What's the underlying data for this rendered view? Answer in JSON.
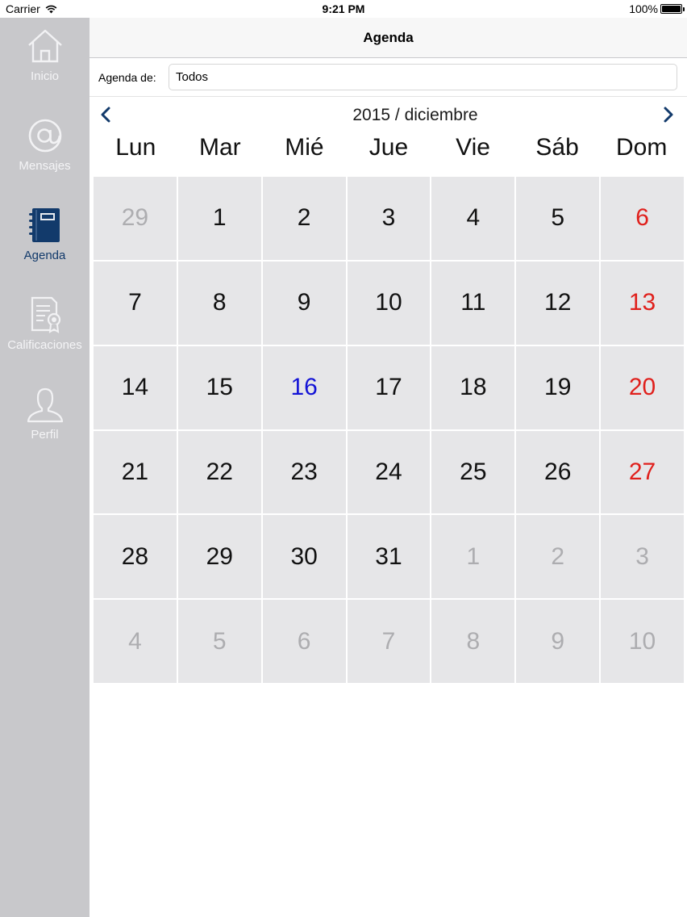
{
  "status_bar": {
    "carrier": "Carrier",
    "time": "9:21 PM",
    "battery": "100%"
  },
  "sidebar": {
    "items": [
      {
        "label": "Inicio",
        "icon": "home-icon",
        "active": false
      },
      {
        "label": "Mensajes",
        "icon": "at-sign-icon",
        "active": false
      },
      {
        "label": "Agenda",
        "icon": "notebook-icon",
        "active": true
      },
      {
        "label": "Calificaciones",
        "icon": "certificate-icon",
        "active": false
      },
      {
        "label": "Perfil",
        "icon": "user-icon",
        "active": false
      }
    ]
  },
  "navbar": {
    "title": "Agenda"
  },
  "filter": {
    "label": "Agenda de:",
    "value": "Todos"
  },
  "calendar": {
    "month_title": "2015 / diciembre",
    "weekdays": [
      "Lun",
      "Mar",
      "Mié",
      "Jue",
      "Vie",
      "Sáb",
      "Dom"
    ],
    "days": [
      {
        "d": "29",
        "type": "other"
      },
      {
        "d": "1",
        "type": "normal"
      },
      {
        "d": "2",
        "type": "normal"
      },
      {
        "d": "3",
        "type": "normal"
      },
      {
        "d": "4",
        "type": "normal"
      },
      {
        "d": "5",
        "type": "normal"
      },
      {
        "d": "6",
        "type": "sun"
      },
      {
        "d": "7",
        "type": "normal"
      },
      {
        "d": "8",
        "type": "normal"
      },
      {
        "d": "9",
        "type": "normal"
      },
      {
        "d": "10",
        "type": "normal"
      },
      {
        "d": "11",
        "type": "normal"
      },
      {
        "d": "12",
        "type": "normal"
      },
      {
        "d": "13",
        "type": "sun"
      },
      {
        "d": "14",
        "type": "normal"
      },
      {
        "d": "15",
        "type": "normal"
      },
      {
        "d": "16",
        "type": "today"
      },
      {
        "d": "17",
        "type": "normal"
      },
      {
        "d": "18",
        "type": "normal"
      },
      {
        "d": "19",
        "type": "normal"
      },
      {
        "d": "20",
        "type": "sun"
      },
      {
        "d": "21",
        "type": "normal"
      },
      {
        "d": "22",
        "type": "normal"
      },
      {
        "d": "23",
        "type": "normal"
      },
      {
        "d": "24",
        "type": "normal"
      },
      {
        "d": "25",
        "type": "normal"
      },
      {
        "d": "26",
        "type": "normal"
      },
      {
        "d": "27",
        "type": "sun"
      },
      {
        "d": "28",
        "type": "normal"
      },
      {
        "d": "29",
        "type": "normal"
      },
      {
        "d": "30",
        "type": "normal"
      },
      {
        "d": "31",
        "type": "normal"
      },
      {
        "d": "1",
        "type": "other"
      },
      {
        "d": "2",
        "type": "other"
      },
      {
        "d": "3",
        "type": "other"
      },
      {
        "d": "4",
        "type": "other"
      },
      {
        "d": "5",
        "type": "other"
      },
      {
        "d": "6",
        "type": "other"
      },
      {
        "d": "7",
        "type": "other"
      },
      {
        "d": "8",
        "type": "other"
      },
      {
        "d": "9",
        "type": "other"
      },
      {
        "d": "10",
        "type": "other"
      }
    ]
  },
  "colors": {
    "accent": "#123a6b",
    "sunday": "#e0201c",
    "today": "#1414d6",
    "sidebar_bg": "#c8c8cb",
    "cell_bg": "#e6e6e8"
  }
}
